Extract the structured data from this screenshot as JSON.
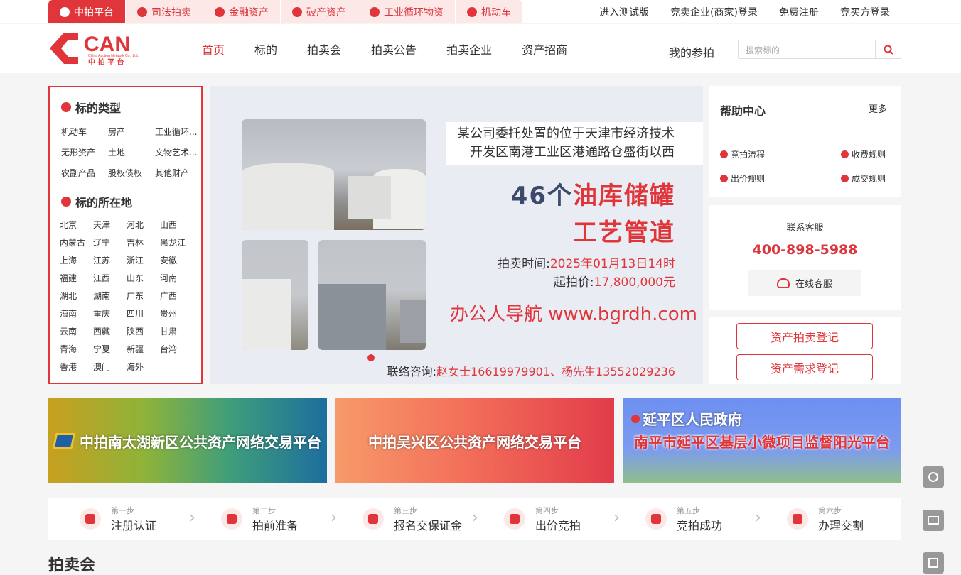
{
  "topbar": {
    "tabs": [
      {
        "label": "中拍平台",
        "icon": "home-icon"
      },
      {
        "label": "司法拍卖",
        "icon": "shield-icon"
      },
      {
        "label": "金融资产",
        "icon": "coin-icon"
      },
      {
        "label": "破产资产",
        "icon": "pie-icon"
      },
      {
        "label": "工业循环物资",
        "icon": "recycle-icon"
      },
      {
        "label": "机动车",
        "icon": "car-icon"
      }
    ],
    "links": [
      "进入测试版",
      "竞卖企业(商家)登录",
      "免费注册",
      "竞买方登录"
    ]
  },
  "logo": {
    "text": "CAN",
    "sub_en": "China Auction Network Co., Ltd.",
    "sub_cn": "中 拍 平 台"
  },
  "nav": {
    "items": [
      "首页",
      "标的",
      "拍卖会",
      "拍卖公告",
      "拍卖企业",
      "资产招商"
    ],
    "my_bid": "我的参拍",
    "search_placeholder": "搜索标的"
  },
  "sidebar": {
    "type_title": "标的类型",
    "types": [
      "机动车",
      "房产",
      "工业循环...",
      "无形资产",
      "土地",
      "文物艺术...",
      "农副产品",
      "股权债权",
      "其他财产"
    ],
    "loc_title": "标的所在地",
    "locations": [
      "北京",
      "天津",
      "河北",
      "山西",
      "内蒙古",
      "辽宁",
      "吉林",
      "黑龙江",
      "上海",
      "江苏",
      "浙江",
      "安徽",
      "福建",
      "江西",
      "山东",
      "河南",
      "湖北",
      "湖南",
      "广东",
      "广西",
      "海南",
      "重庆",
      "四川",
      "贵州",
      "云南",
      "西藏",
      "陕西",
      "甘肃",
      "青海",
      "宁夏",
      "新疆",
      "台湾",
      "香港",
      "澳门",
      "海外"
    ]
  },
  "banner": {
    "desc_line1": "某公司委托处置的位于天津市经济技术",
    "desc_line2": "开发区南港工业区港通路仓盛街以西",
    "big_line1_prefix": "46个",
    "big_line1_red": "油库储罐",
    "big_line2": "工艺管道",
    "time_label": "拍卖时间:",
    "time_value": "2025年01月13日14时",
    "price_label": "起拍价:",
    "price_value": "17,800,000元",
    "contact_label": "联络咨询:",
    "contact_value": "赵女士16619979901、杨先生13552029236",
    "watermark": "办公人导航 www.bgrdh.com"
  },
  "help": {
    "title": "帮助中心",
    "more": "更多",
    "items": [
      "竞拍流程",
      "收费规则",
      "出价规则",
      "成交规则"
    ]
  },
  "service": {
    "title": "联系客服",
    "phone": "400-898-5988",
    "online": "在线客服"
  },
  "register": {
    "asset_auction": "资产拍卖登记",
    "asset_demand": "资产需求登记"
  },
  "promos": [
    {
      "text": "中拍南太湖新区公共资产网络交易平台"
    },
    {
      "text": "中拍吴兴区公共资产网络交易平台"
    },
    {
      "text": "南平市延平区基层小微项目监督阳光平台",
      "badge": "延平区人民政府"
    }
  ],
  "steps": [
    {
      "step": "第一步",
      "label": "注册认证",
      "icon": "user-icon"
    },
    {
      "step": "第二步",
      "label": "拍前准备",
      "icon": "document-icon"
    },
    {
      "step": "第三步",
      "label": "报名交保证金",
      "icon": "lock-icon"
    },
    {
      "step": "第四步",
      "label": "出价竞拍",
      "icon": "bid-sign-icon"
    },
    {
      "step": "第五步",
      "label": "竞拍成功",
      "icon": "gavel-icon"
    },
    {
      "step": "第六步",
      "label": "办理交割",
      "icon": "exchange-icon"
    }
  ],
  "section": {
    "auction_title": "拍卖会"
  },
  "colors": {
    "brand": "#e0353b",
    "tab_bg": "#fde8e8"
  }
}
